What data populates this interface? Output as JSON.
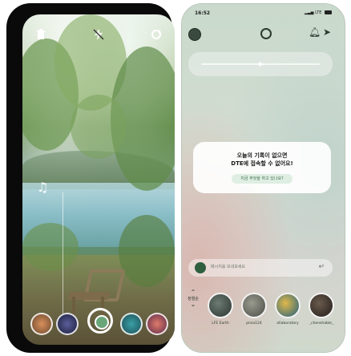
{
  "left_screen": {
    "icons": {
      "top_left": "trash-icon",
      "top_center": "flash-off-icon",
      "top_right": "switch-camera-icon",
      "side": "music-note-icon"
    },
    "filters": [
      "filter-warm",
      "filter-night",
      "filter-active",
      "filter-teal",
      "filter-sunset"
    ]
  },
  "right_screen": {
    "status": {
      "time": "16:52",
      "right": "LTE"
    },
    "notice": {
      "line1": "오늘의 기록이 없으면",
      "line2": "DTE에 접속할 수 없어요!",
      "button": "지금 무엇을 하고 있나요?"
    },
    "comment": {
      "placeholder": "메시지를 보내보세요"
    },
    "sort_label": "정렬순",
    "friends": [
      {
        "name": "LFE Earth",
        "color": "#3e4a44"
      },
      {
        "name": "pinia124",
        "color": "#6b6f66"
      },
      {
        "name": "ollaboratory",
        "color": "#2f6f8f"
      },
      {
        "name": "_chenshable_",
        "color": "#433a33"
      }
    ]
  }
}
